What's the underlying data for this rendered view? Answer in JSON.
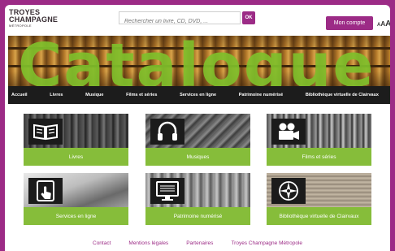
{
  "header": {
    "logo_line1": "TROYES",
    "logo_line2": "CHAMPAGNE",
    "logo_sub": "MÉTROPOLE",
    "search_placeholder": "Rechercher un livre, CD, DVD, ...",
    "search_button": "OK",
    "account_button": "Mon compte",
    "text_size": [
      "A",
      "A",
      "A"
    ]
  },
  "banner": {
    "title": "Catalogue"
  },
  "nav": {
    "items": [
      "Accueil",
      "Livres",
      "Musique",
      "Films et séries",
      "Services en ligne",
      "Patrimoine numérisé",
      "Bibliothèque virtuelle de Clairvaux"
    ]
  },
  "tiles": [
    {
      "label": "Livres",
      "icon": "book-icon"
    },
    {
      "label": "Musiques",
      "icon": "headphones-icon"
    },
    {
      "label": "Films et séries",
      "icon": "movie-camera-icon"
    },
    {
      "label": "Services en ligne",
      "icon": "tablet-touch-icon"
    },
    {
      "label": "Patrimoine numérisé",
      "icon": "monitor-icon"
    },
    {
      "label": "Bibliothèque virtuelle de Clairvaux",
      "icon": "compass-rose-icon"
    }
  ],
  "footer": {
    "links": [
      "Contact",
      "Mentions légales",
      "Partenaires",
      "Troyes Champagne Métropole"
    ]
  },
  "colors": {
    "brand": "#9c2b86",
    "accent": "#86bd3a",
    "nav_bg": "#1c1c1c"
  }
}
